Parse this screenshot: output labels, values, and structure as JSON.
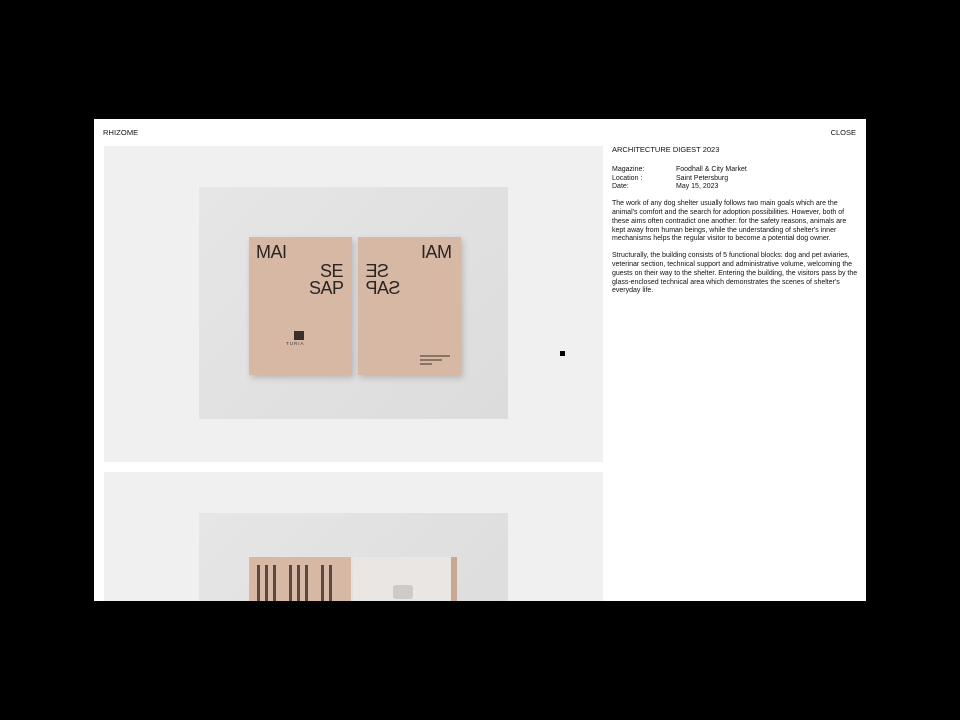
{
  "header": {
    "brand": "RHIZOME",
    "close_label": "CLOSE"
  },
  "article": {
    "title": "ARCHITECTURE DIGEST 2023",
    "meta": [
      {
        "key": "Magazine:",
        "value": "Foodhall & City Market"
      },
      {
        "key": "Location :",
        "value": "Saint Petersburg"
      },
      {
        "key": "Date:",
        "value": "May 15, 2023"
      }
    ],
    "paragraphs": [
      "The work of any dog shelter usually follows two main goals which are the animal's comfort and the search for adoption possibilities. However, both of these aims often contradict one another: for the safety reasons, animals are kept away from human beings, while the understanding of shelter's inner mechanisms helps the regular visitor to become a potential dog owner.",
      "Structurally, the building consists of 5 functional blocks: dog and pet aviaries, veterinar section, technical support and administrative volume, welcoming the guests on their way to the shelter. Entering the building, the visitors pass by the glass-enclosed technical area which demonstrates the scenes of shelter's everyday life."
    ]
  },
  "gallery": {
    "book_left": {
      "line1": "MAI",
      "line2": "SE",
      "line3": "SAP",
      "logo": "TURIA"
    },
    "book_right": {
      "line1": "IAM",
      "line2": "SE",
      "line3": "SAP"
    }
  },
  "colors": {
    "book": "#d6b8a4",
    "backdrop": "#e0e0e0",
    "frame": "#000000"
  }
}
